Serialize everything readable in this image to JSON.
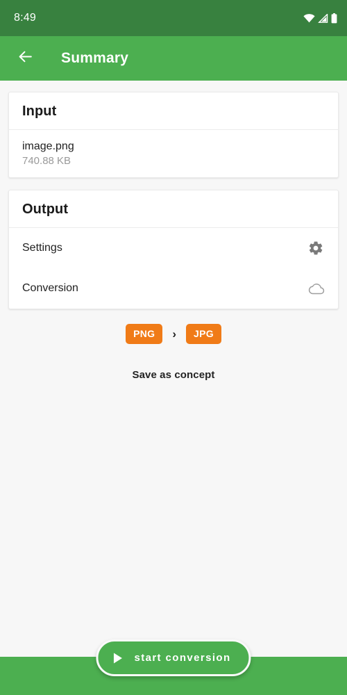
{
  "status_bar": {
    "time": "8:49",
    "icons": [
      "wifi-icon",
      "cellular-signal-icon",
      "battery-icon"
    ]
  },
  "app_bar": {
    "back_icon": "arrow-left-icon",
    "title": "Summary"
  },
  "cards": {
    "input": {
      "header": "Input",
      "file_name": "image.png",
      "file_size": "740.88 KB"
    },
    "output": {
      "header": "Output",
      "rows": [
        {
          "label": "Settings",
          "icon": "gear-icon"
        },
        {
          "label": "Conversion",
          "icon": "cloud-icon"
        }
      ]
    }
  },
  "format": {
    "source": "PNG",
    "separator": "›",
    "target": "JPG"
  },
  "save_concept_label": "Save as concept",
  "fab": {
    "label": "start conversion",
    "icon": "play-icon"
  },
  "colors": {
    "status_bar_green": "#38813F",
    "app_bar_green": "#4CAF50",
    "badge_orange": "#F07B17",
    "page_background": "#F7F7F7",
    "card_white": "#FFFFFF",
    "icon_gray": "#7A7A7A",
    "cloud_gray": "#9E9E9E",
    "subtext_gray": "#9A9A9A"
  }
}
